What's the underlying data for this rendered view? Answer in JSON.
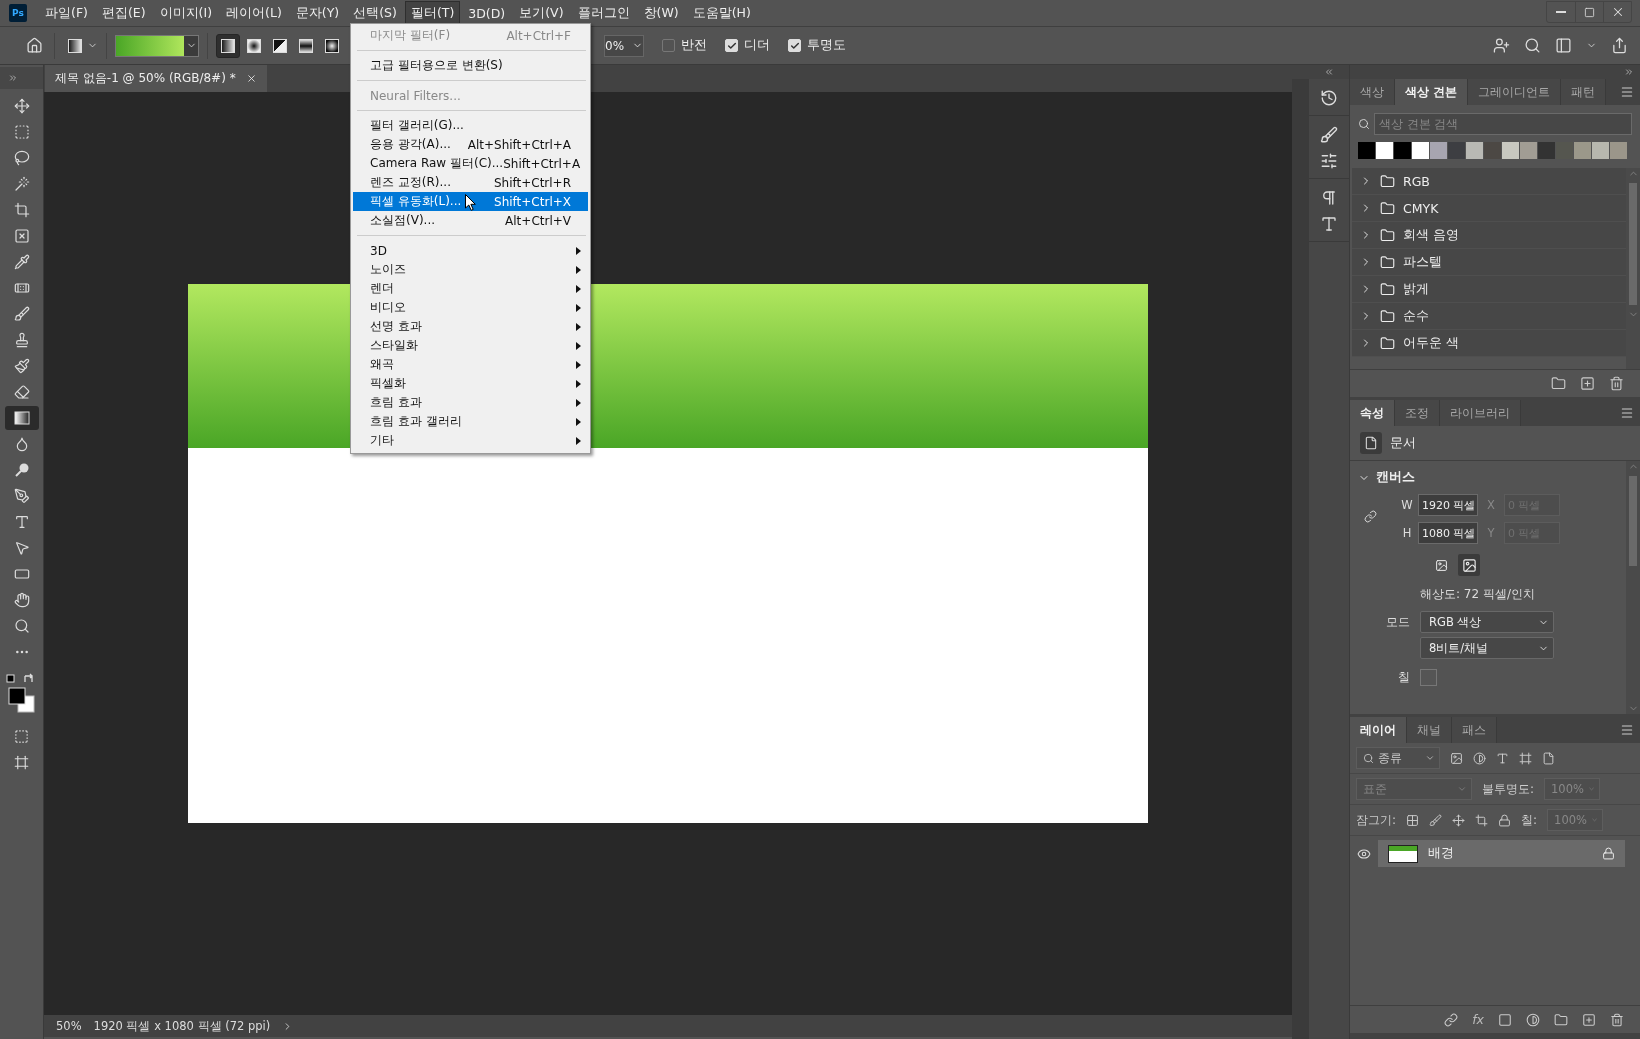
{
  "menu_bar": {
    "logo": "Ps",
    "items": [
      {
        "label": "파일(F)",
        "selected": false
      },
      {
        "label": "편집(E)",
        "selected": false
      },
      {
        "label": "이미지(I)",
        "selected": false
      },
      {
        "label": "레이어(L)",
        "selected": false
      },
      {
        "label": "문자(Y)",
        "selected": false
      },
      {
        "label": "선택(S)",
        "selected": false
      },
      {
        "label": "필터(T)",
        "selected": true
      },
      {
        "label": "3D(D)",
        "selected": false
      },
      {
        "label": "보기(V)",
        "selected": false
      },
      {
        "label": "플러그인",
        "selected": false
      },
      {
        "label": "창(W)",
        "selected": false
      },
      {
        "label": "도움말(H)",
        "selected": false
      }
    ]
  },
  "options_bar": {
    "gradient_types": [
      {
        "kind": "linear",
        "selected": true
      },
      {
        "kind": "radial",
        "selected": false
      },
      {
        "kind": "angle",
        "selected": false
      },
      {
        "kind": "reflected",
        "selected": false
      },
      {
        "kind": "diamond",
        "selected": false
      }
    ],
    "opacity": "0%",
    "checkboxes": [
      {
        "label": "반전",
        "checked": false
      },
      {
        "label": "디더",
        "checked": true
      },
      {
        "label": "투명도",
        "checked": true
      }
    ]
  },
  "document_tab": {
    "title": "제목 없음-1 @ 50% (RGB/8#) *"
  },
  "tools": [
    {
      "kind": "move",
      "selected": false
    },
    {
      "kind": "marquee",
      "selected": false
    },
    {
      "kind": "lasso",
      "selected": false
    },
    {
      "kind": "wand",
      "selected": false
    },
    {
      "kind": "crop",
      "selected": false
    },
    {
      "kind": "frame",
      "selected": false
    },
    {
      "kind": "eyedropper",
      "selected": false
    },
    {
      "kind": "healing",
      "selected": false
    },
    {
      "kind": "brush",
      "selected": false
    },
    {
      "kind": "stamp",
      "selected": false
    },
    {
      "kind": "history",
      "selected": false
    },
    {
      "kind": "eraser",
      "selected": false
    },
    {
      "kind": "gradient",
      "selected": true
    },
    {
      "kind": "blur",
      "selected": false
    },
    {
      "kind": "dodge",
      "selected": false
    },
    {
      "kind": "pen",
      "selected": false
    },
    {
      "kind": "type",
      "selected": false
    },
    {
      "kind": "path",
      "selected": false
    },
    {
      "kind": "rectangle",
      "selected": false
    },
    {
      "kind": "hand",
      "selected": false
    },
    {
      "kind": "zoom",
      "selected": false
    },
    {
      "kind": "more",
      "selected": false
    }
  ],
  "filter_menu": {
    "items": [
      {
        "kind": "item",
        "label": "마지막 필터(F)",
        "shortcut": "Alt+Ctrl+F",
        "disabled": true,
        "selected": false
      },
      {
        "kind": "separator"
      },
      {
        "kind": "item",
        "label": "고급 필터용으로 변환(S)",
        "disabled": false,
        "selected": false
      },
      {
        "kind": "separator"
      },
      {
        "kind": "item",
        "label": "Neural Filters...",
        "disabled": true,
        "selected": false
      },
      {
        "kind": "separator"
      },
      {
        "kind": "item",
        "label": "필터 갤러리(G)...",
        "disabled": false,
        "selected": false
      },
      {
        "kind": "item",
        "label": "응용 광각(A)...",
        "shortcut": "Alt+Shift+Ctrl+A",
        "disabled": false,
        "selected": false
      },
      {
        "kind": "item",
        "label": "Camera Raw 필터(C)...",
        "shortcut": "Shift+Ctrl+A",
        "disabled": false,
        "selected": false
      },
      {
        "kind": "item",
        "label": "렌즈 교정(R)...",
        "shortcut": "Shift+Ctrl+R",
        "disabled": false,
        "selected": false
      },
      {
        "kind": "item",
        "label": "픽셀 유동화(L)...",
        "shortcut": "Shift+Ctrl+X",
        "disabled": false,
        "selected": true
      },
      {
        "kind": "item",
        "label": "소실점(V)...",
        "shortcut": "Alt+Ctrl+V",
        "disabled": false,
        "selected": false
      },
      {
        "kind": "separator"
      },
      {
        "kind": "submenu",
        "label": "3D",
        "selected": false
      },
      {
        "kind": "submenu",
        "label": "노이즈",
        "selected": false
      },
      {
        "kind": "submenu",
        "label": "렌더",
        "selected": false
      },
      {
        "kind": "submenu",
        "label": "비디오",
        "selected": false
      },
      {
        "kind": "submenu",
        "label": "선명 효과",
        "selected": false
      },
      {
        "kind": "submenu",
        "label": "스타일화",
        "selected": false
      },
      {
        "kind": "submenu",
        "label": "왜곡",
        "selected": false
      },
      {
        "kind": "submenu",
        "label": "픽셀화",
        "selected": false
      },
      {
        "kind": "submenu",
        "label": "흐림 효과",
        "selected": false
      },
      {
        "kind": "submenu",
        "label": "흐림 효과 갤러리",
        "selected": false
      },
      {
        "kind": "submenu",
        "label": "기타",
        "selected": false
      }
    ]
  },
  "swatches_panel": {
    "tabs": [
      {
        "label": "색상",
        "selected": false
      },
      {
        "label": "색상 견본",
        "selected": true
      },
      {
        "label": "그레이디언트",
        "selected": false
      },
      {
        "label": "패턴",
        "selected": false
      }
    ],
    "search": {
      "placeholder": "색상 견본 검색"
    },
    "swatches": [
      {
        "color": "#000000"
      },
      {
        "color": "#ffffff"
      },
      {
        "color": "#000000"
      },
      {
        "color": "#ffffff"
      },
      {
        "color": "#a7a5b0"
      },
      {
        "color": "#3d3e42"
      },
      {
        "color": "#b9b9b4"
      },
      {
        "color": "#4c4844"
      },
      {
        "color": "#c8c8c0"
      },
      {
        "color": "#a19d94"
      },
      {
        "color": "#333333"
      },
      {
        "color": "#55564f"
      },
      {
        "color": "#9b988a"
      },
      {
        "color": "#b7b7ae"
      },
      {
        "color": "#9b968a"
      }
    ],
    "groups": [
      {
        "name": "RGB",
        "expanded": false
      },
      {
        "name": "CMYK",
        "expanded": false
      },
      {
        "name": "회색 음영",
        "expanded": false
      },
      {
        "name": "파스텔",
        "expanded": false
      },
      {
        "name": "밝게",
        "expanded": false
      },
      {
        "name": "순수",
        "expanded": false
      },
      {
        "name": "어두운 색",
        "expanded": false
      }
    ]
  },
  "properties_panel": {
    "tabs": [
      {
        "label": "속성",
        "selected": true
      },
      {
        "label": "조정",
        "selected": false
      },
      {
        "label": "라이브러리",
        "selected": false
      }
    ],
    "document_label": "문서",
    "section": {
      "title": "캔버스",
      "expanded": true
    },
    "fields": [
      {
        "label": "W",
        "value": "1920 픽셀",
        "disabled": false
      },
      {
        "label": "X",
        "value": "0 픽셀",
        "disabled": true
      },
      {
        "label": "H",
        "value": "1080 픽셀",
        "disabled": false
      },
      {
        "label": "Y",
        "value": "0 픽셀",
        "disabled": true
      }
    ],
    "orientations": [
      {
        "kind": "portrait",
        "selected": false
      },
      {
        "kind": "landscape",
        "selected": true
      }
    ],
    "resolution": "해상도: 72 픽셀/인치",
    "mode_label": "모드",
    "mode": "RGB 색상",
    "depth": "8비트/채널",
    "fill_label": "칠"
  },
  "layers_panel": {
    "tabs": [
      {
        "label": "레이어",
        "selected": true
      },
      {
        "label": "채널",
        "selected": false
      },
      {
        "label": "패스",
        "selected": false
      }
    ],
    "filter": {
      "placeholder": "종류"
    },
    "blend_mode": {
      "value": "표준",
      "disabled": true
    },
    "opacity_label": "불투명도:",
    "opacity": "100%",
    "lock_label": "잠그기:",
    "fill_label": "칠:",
    "fill": "100%",
    "layers": [
      {
        "name": "배경",
        "visible": true,
        "locked": true,
        "selected": true
      }
    ],
    "effects_button": "fx"
  },
  "status_bar": {
    "zoom": "50%",
    "info": "1920 픽셀 x 1080 픽셀 (72 ppi)"
  }
}
